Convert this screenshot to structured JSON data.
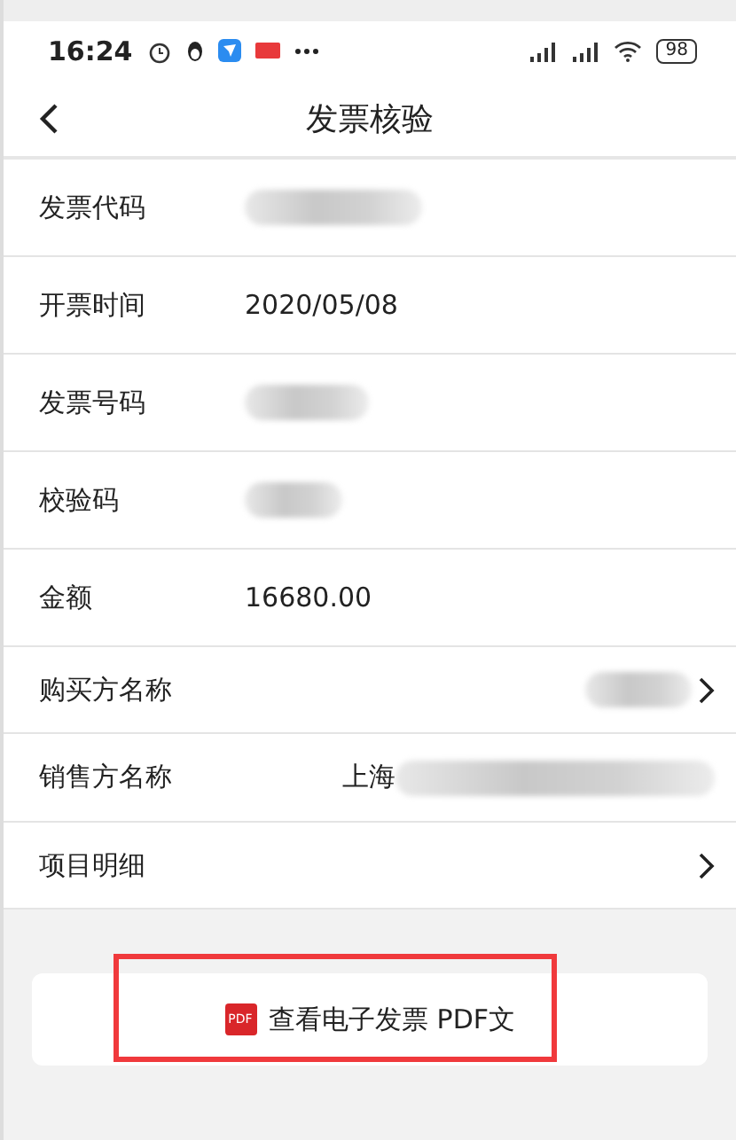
{
  "status_bar": {
    "time": "16:24",
    "battery": "98"
  },
  "nav": {
    "title": "发票核验"
  },
  "rows": [
    {
      "label": "发票代码",
      "kind": "plain",
      "blurred": true
    },
    {
      "label": "开票时间",
      "kind": "plain",
      "value": "2020/05/08",
      "blurred": false
    },
    {
      "label": "发票号码",
      "kind": "plain",
      "blurred": true
    },
    {
      "label": "校验码",
      "kind": "plain",
      "blurred": true
    },
    {
      "label": "金额",
      "kind": "plain",
      "value": "16680.00",
      "blurred": false
    },
    {
      "label": "购买方名称",
      "kind": "link",
      "blurred": true
    },
    {
      "label": "销售方名称",
      "kind": "wide",
      "value": "上海",
      "blurred": true
    },
    {
      "label": "项目明细",
      "kind": "link",
      "blurred": false
    }
  ],
  "pdf_button": {
    "icon_text": "PDF",
    "label": "查看电子发票 PDF文",
    "highlighted": true
  }
}
